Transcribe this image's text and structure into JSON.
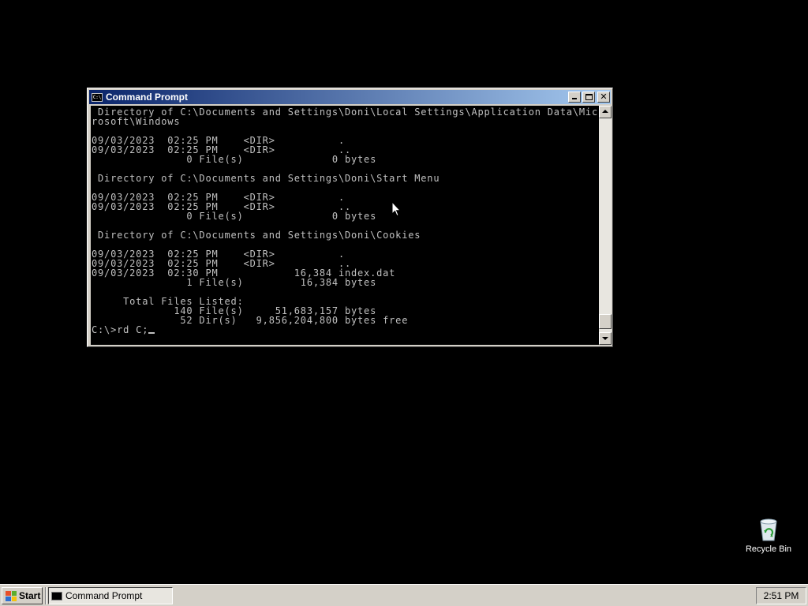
{
  "window": {
    "title": "Command Prompt",
    "icon_text": "C:\\",
    "icons": {
      "app": "console-icon",
      "minimize": "minimize-icon",
      "maximize": "maximize-icon",
      "close": "close-icon"
    }
  },
  "console": {
    "text_color": "#c0c0c0",
    "background_color": "#000000",
    "output": " Directory of C:\\Documents and Settings\\Doni\\Local Settings\\Application Data\\Mic\nrosoft\\Windows\n\n09/03/2023  02:25 PM    <DIR>          .\n09/03/2023  02:25 PM    <DIR>          ..\n               0 File(s)              0 bytes\n\n Directory of C:\\Documents and Settings\\Doni\\Start Menu\n\n09/03/2023  02:25 PM    <DIR>          .\n09/03/2023  02:25 PM    <DIR>          ..\n               0 File(s)              0 bytes\n\n Directory of C:\\Documents and Settings\\Doni\\Cookies\n\n09/03/2023  02:25 PM    <DIR>          .\n09/03/2023  02:25 PM    <DIR>          ..\n09/03/2023  02:30 PM            16,384 index.dat\n               1 File(s)         16,384 bytes\n\n     Total Files Listed:\n             140 File(s)     51,683,157 bytes\n              52 Dir(s)   9,856,204,800 bytes free\n",
    "prompt": "C:\\>rd C;"
  },
  "desktop": {
    "recycle_bin_label": "Recycle Bin",
    "recycle_bin_icon": "recycle-bin-icon"
  },
  "taskbar": {
    "start_label": "Start",
    "task_label": "Command Prompt",
    "clock": "2:51 PM",
    "start_logo_colors": [
      "#e8502a",
      "#5cad2c",
      "#2f6fd1",
      "#f4c20d"
    ]
  }
}
